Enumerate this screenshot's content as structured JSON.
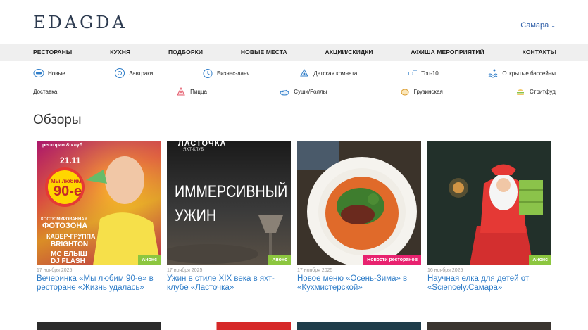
{
  "header": {
    "logo": "EDAGDA",
    "city": "Самара"
  },
  "main_nav": [
    "РЕСТОРАНЫ",
    "КУХНЯ",
    "ПОДБОРКИ",
    "НОВЫЕ МЕСТА",
    "АКЦИИ/СКИДКИ",
    "АФИША МЕРОПРИЯТИЙ",
    "КОНТАКТЫ"
  ],
  "categories": [
    {
      "label": "Новые",
      "icon": "new-badge-icon"
    },
    {
      "label": "Завтраки",
      "icon": "breakfast-icon"
    },
    {
      "label": "Бизнес-ланч",
      "icon": "clock-icon"
    },
    {
      "label": "Детская комната",
      "icon": "kids-room-icon"
    },
    {
      "label": "Топ-10",
      "icon": "top-10-icon"
    },
    {
      "label": "Открытые бассейны",
      "icon": "pool-icon"
    }
  ],
  "delivery": {
    "label": "Доставка:",
    "items": [
      {
        "label": "Пицца",
        "icon": "pizza-icon"
      },
      {
        "label": "Суши/Роллы",
        "icon": "sushi-icon"
      },
      {
        "label": "Грузинская",
        "icon": "georgian-icon"
      },
      {
        "label": "Стритфуд",
        "icon": "burger-icon"
      }
    ]
  },
  "section_title": "Обзоры",
  "reviews": [
    {
      "date": "17 ноября 2025",
      "title": "Вечеринка «Мы любим 90-е» в ресторане «Жизнь удалась»",
      "badge": "Анонс",
      "badge_color": "#8cc63f",
      "poster_lines": [
        "ресторан & клуб",
        "21.11",
        "Мы любим",
        "90-е",
        "КОСТЮМИРОВАННАЯ",
        "ФОТОЗОНА",
        "КАВЕР-ГРУППА",
        "BRIGHTON",
        "MC ЕЛЫШ",
        "DJ FLASH"
      ]
    },
    {
      "date": "17 ноября 2025",
      "title": "Ужин в стиле XIX века в яхт-клубе «Ласточка»",
      "badge": "Анонс",
      "badge_color": "#8cc63f",
      "poster_lines": [
        "ЛАСТОЧКА",
        "ЯХТ-КЛУБ",
        "ИММЕРСИВНЫЙ",
        "УЖИН"
      ]
    },
    {
      "date": "17 ноября 2025",
      "title": "Новое меню «Осень-Зима» в «Кухмистерской»",
      "badge": "Новости ресторанов",
      "badge_color": "#e8226f",
      "poster_lines": []
    },
    {
      "date": "16 ноября 2025",
      "title": "Научная елка для детей от «Sciencely.Самара»",
      "badge": "Анонс",
      "badge_color": "#8cc63f",
      "poster_lines": []
    }
  ],
  "colors": {
    "link": "#2f7dc8",
    "nav_bg": "#efefef",
    "logo": "#2c3a4f"
  }
}
